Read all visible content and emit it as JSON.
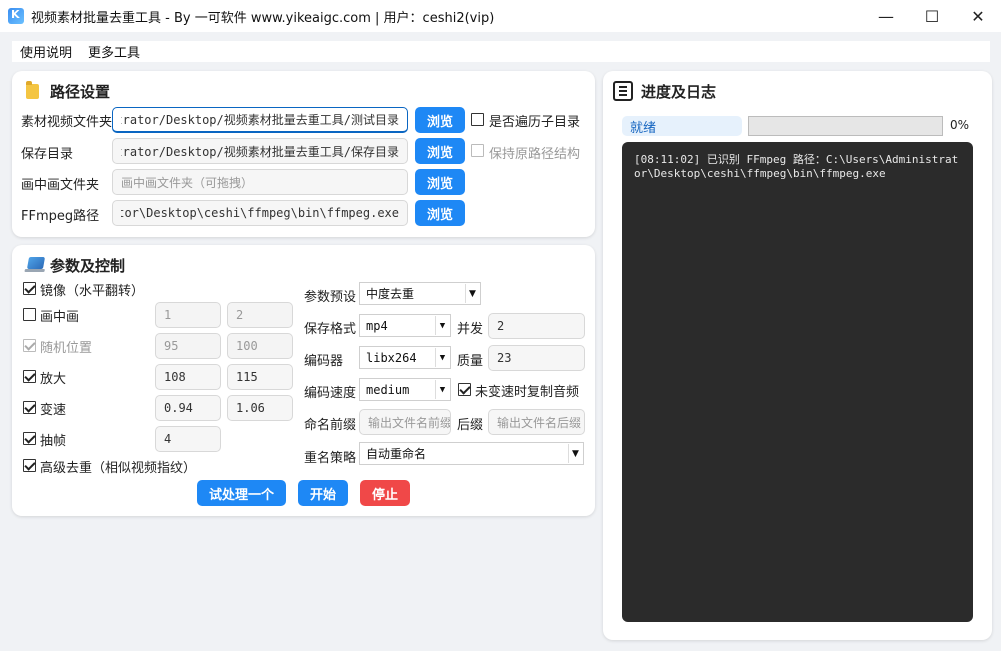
{
  "window": {
    "title": "视频素材批量去重工具 - By 一可软件 www.yikeaigc.com | 用户：ceshi2(vip)",
    "minimize": "—",
    "maximize": "☐",
    "close": "✕"
  },
  "menu": {
    "items": [
      "使用说明",
      "更多工具"
    ]
  },
  "path_panel": {
    "title": "路径设置",
    "rows": [
      {
        "label": "素材视频文件夹",
        "value": "C:/Users/Administrator/Desktop/视频素材批量去重工具/测试目录",
        "browse": "浏览"
      },
      {
        "label": "保存目录",
        "value": "C:/Users/Administrator/Desktop/视频素材批量去重工具/保存目录",
        "browse": "浏览"
      },
      {
        "label": "画中画文件夹",
        "placeholder": "画中画文件夹（可拖拽）",
        "browse": "浏览"
      },
      {
        "label": "FFmpeg路径",
        "value": "C:\\Users\\Administrator\\Desktop\\ceshi\\ffmpeg\\bin\\ffmpeg.exe",
        "browse": "浏览"
      }
    ],
    "recurse_subdirs": {
      "label": "是否遍历子目录",
      "checked": false
    },
    "keep_structure": {
      "label": "保持原路径结构",
      "checked": false,
      "disabled": true
    }
  },
  "params_panel": {
    "title": "参数及控制",
    "mirror": {
      "label": "镜像（水平翻转）",
      "checked": true
    },
    "pip": {
      "label": "画中画",
      "checked": false,
      "min": "1",
      "max": "2"
    },
    "random_pos": {
      "label": "随机位置",
      "checked": true,
      "disabled": true,
      "min": "95",
      "max": "100"
    },
    "zoom": {
      "label": "放大",
      "checked": true,
      "min": "108",
      "max": "115"
    },
    "speed": {
      "label": "变速",
      "checked": true,
      "min": "0.94",
      "max": "1.06"
    },
    "drop_frames": {
      "label": "抽帧",
      "checked": true,
      "value": "4"
    },
    "advanced": {
      "label": "高级去重（相似视频指纹）",
      "checked": true
    },
    "preset": {
      "label": "参数预设",
      "value": "中度去重"
    },
    "format": {
      "label": "保存格式",
      "value": "mp4"
    },
    "concurrency": {
      "label": "并发",
      "value": "2"
    },
    "encoder": {
      "label": "编码器",
      "value": "libx264"
    },
    "quality": {
      "label": "质量",
      "value": "23"
    },
    "enc_speed": {
      "label": "编码速度",
      "value": "medium"
    },
    "copy_audio": {
      "label": "未变速时复制音频",
      "checked": true
    },
    "prefix": {
      "label": "命名前缀",
      "placeholder": "输出文件名前缀"
    },
    "suffix": {
      "label": "后缀",
      "placeholder": "输出文件名后缀"
    },
    "rename": {
      "label": "重名策略",
      "value": "自动重命名"
    },
    "buttons": {
      "trial": "试处理一个",
      "start": "开始",
      "stop": "停止"
    }
  },
  "log_panel": {
    "title": "进度及日志",
    "status": "就绪",
    "progress": 0,
    "progress_text": "0%",
    "log": "[08:11:02] 已识别 FFmpeg 路径：C:\\Users\\Administrator\\Desktop\\ceshi\\ffmpeg\\bin\\ffmpeg.exe"
  },
  "colors": {
    "accent": "#1e88f5",
    "stop": "#f04848",
    "status_text": "#1565c0",
    "log_bg": "#2b2b2b"
  }
}
